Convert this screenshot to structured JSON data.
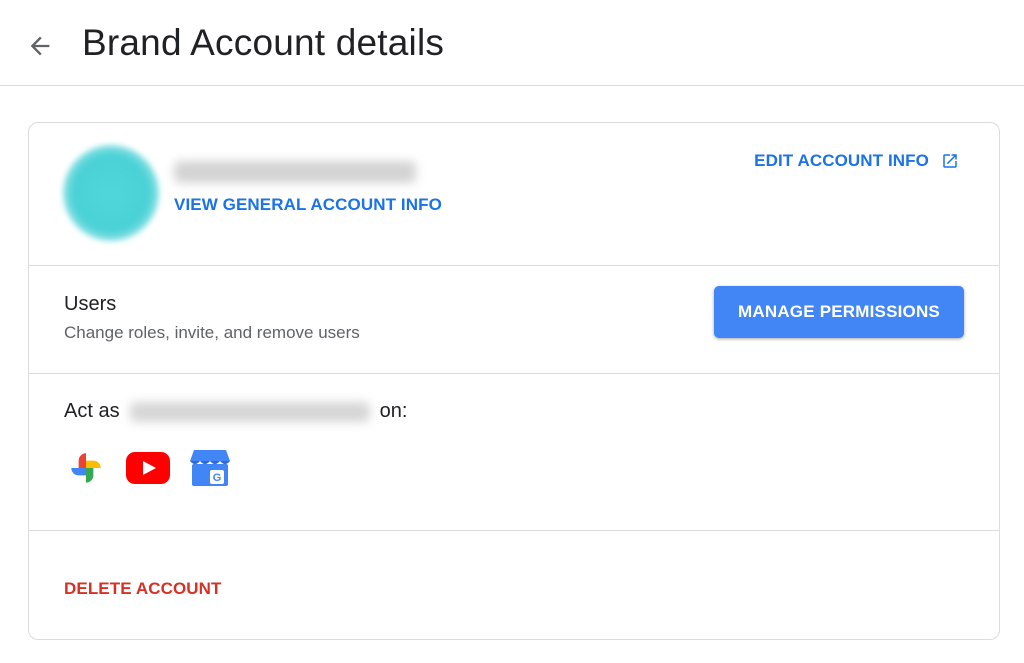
{
  "header": {
    "title": "Brand Account details",
    "back_icon": "arrow-back-icon"
  },
  "account": {
    "view_info_label": "VIEW GENERAL ACCOUNT INFO",
    "edit_info_label": "EDIT ACCOUNT INFO",
    "edit_icon": "open-in-new-icon",
    "avatar_color": "#4fd8dc"
  },
  "users": {
    "label": "Users",
    "description": "Change roles, invite, and remove users",
    "manage_label": "MANAGE PERMISSIONS"
  },
  "act_as": {
    "prefix": "Act as",
    "suffix": "on:",
    "apps": [
      "google-photos-icon",
      "youtube-icon",
      "google-my-business-icon"
    ]
  },
  "danger": {
    "delete_label": "DELETE ACCOUNT",
    "color": "#d93025"
  },
  "colors": {
    "accent": "#1a73e8",
    "button": "#4285f4",
    "divider": "#dadce0"
  }
}
